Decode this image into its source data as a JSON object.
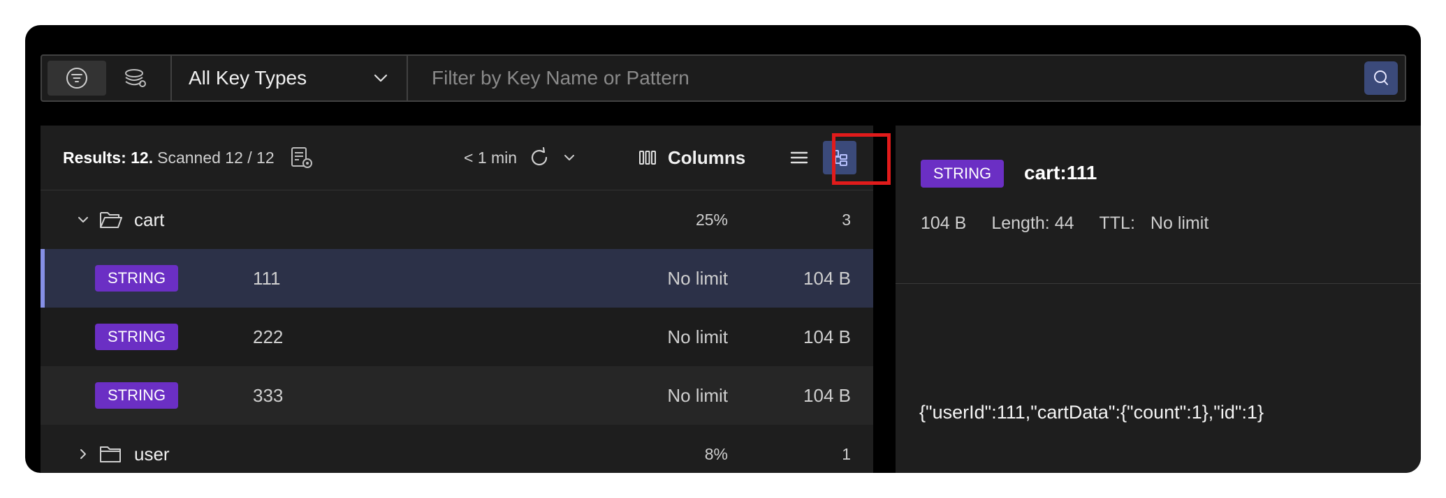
{
  "filter": {
    "key_type": "All Key Types",
    "search_placeholder": "Filter by Key Name or Pattern"
  },
  "list": {
    "results_label": "Results: 12.",
    "scanned_label": "Scanned 12 / 12",
    "refresh_label": "< 1 min",
    "columns_label": "Columns",
    "rows": [
      {
        "kind": "folder",
        "expanded": true,
        "name": "cart",
        "percent": "25%",
        "count": "3"
      },
      {
        "kind": "key",
        "type": "STRING",
        "name": "111",
        "ttl": "No limit",
        "size": "104 B",
        "selected": true
      },
      {
        "kind": "key",
        "type": "STRING",
        "name": "222",
        "ttl": "No limit",
        "size": "104 B"
      },
      {
        "kind": "key",
        "type": "STRING",
        "name": "333",
        "ttl": "No limit",
        "size": "104 B"
      },
      {
        "kind": "folder",
        "expanded": false,
        "name": "user",
        "percent": "8%",
        "count": "1"
      }
    ]
  },
  "detail": {
    "type": "STRING",
    "key": "cart:111",
    "size": "104 B",
    "length": "Length: 44",
    "ttl_label": "TTL:",
    "ttl_value": "No limit",
    "value": "{\"userId\":111,\"cartData\":{\"count\":1},\"id\":1}"
  },
  "colors": {
    "badge_string": "#6b2fc4",
    "accent": "#3b4a7a",
    "selected_row": "#2c3148",
    "highlight": "#e11b1b"
  }
}
